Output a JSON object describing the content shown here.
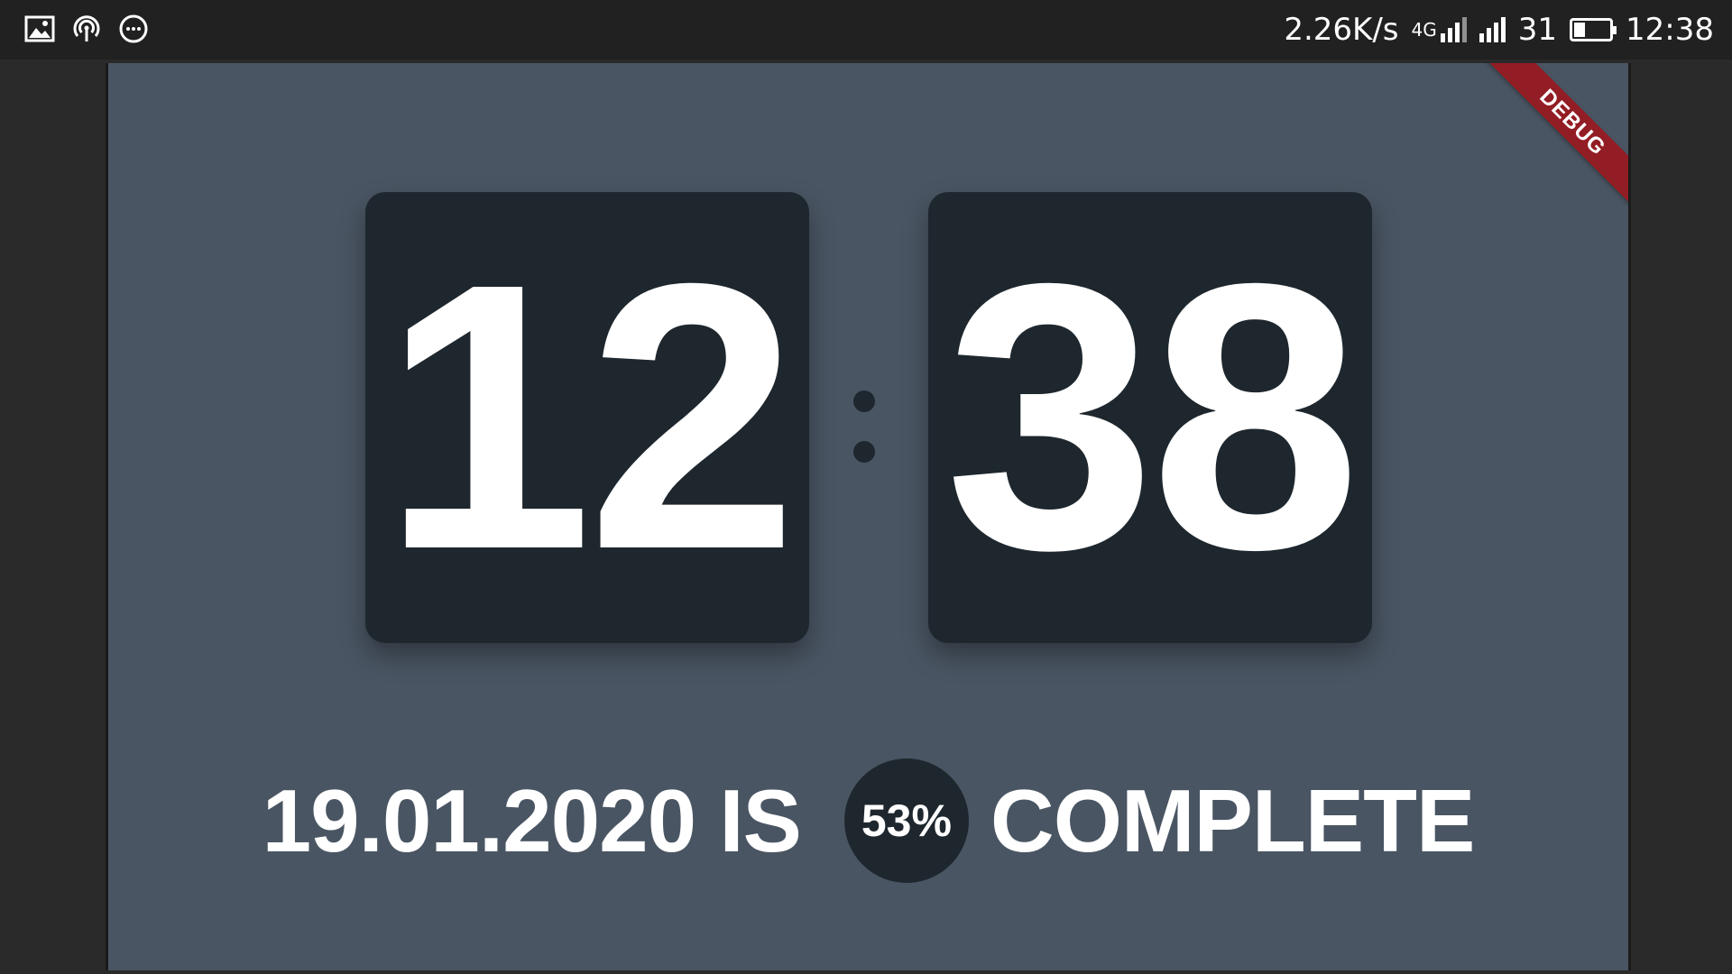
{
  "status_bar": {
    "left_icons": [
      "image-icon",
      "hotspot-icon",
      "more-dots-icon"
    ],
    "network_speed": "2.26K/s",
    "network_type": "4G",
    "battery_percent": "31",
    "battery_level": 0.31,
    "time": "12:38"
  },
  "debug_banner": "DEBUG",
  "clock": {
    "hours": "12",
    "minutes": "38"
  },
  "progress": {
    "date_text": "19.01.2020 IS",
    "percent_text": "53%",
    "complete_text": "COMPLETE"
  },
  "colors": {
    "background": "#4a5563",
    "card": "#1e272e",
    "text": "#ffffff",
    "statusbar": "#212121",
    "debug_banner": "#a01419"
  }
}
